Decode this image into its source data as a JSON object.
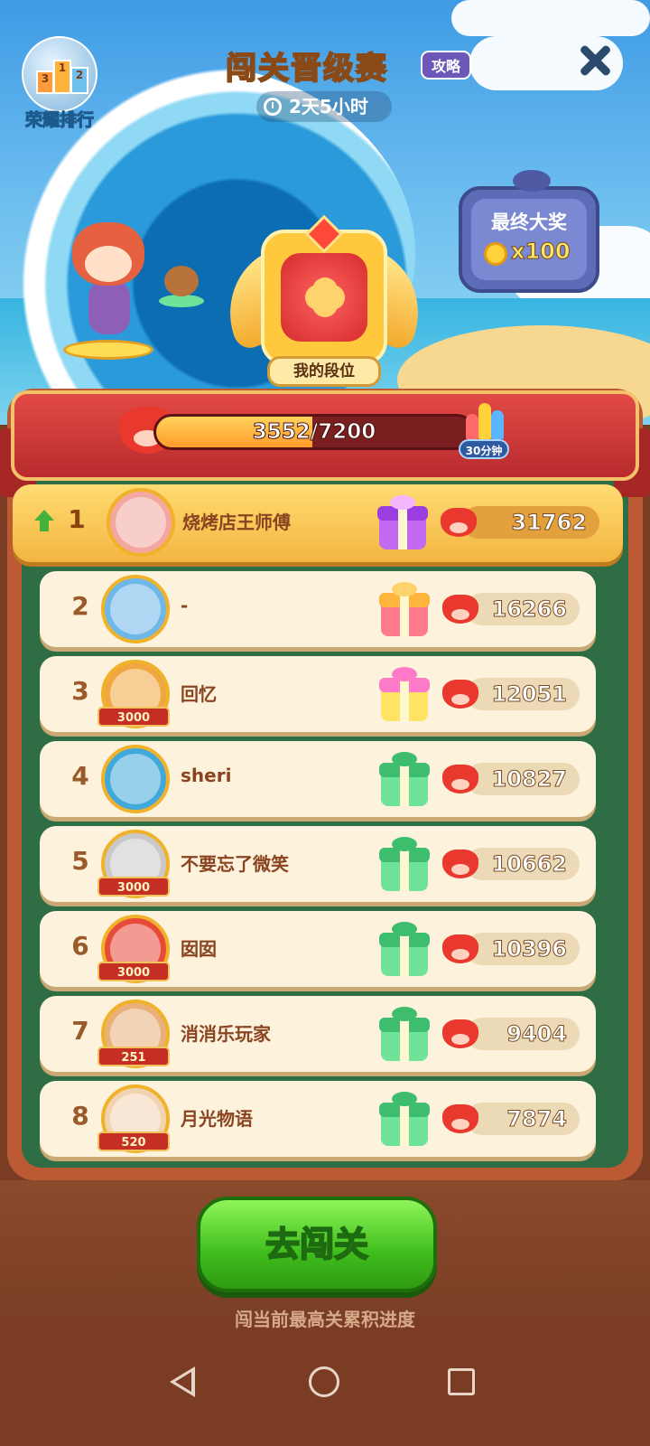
{
  "header": {
    "title": "闯关晋级赛",
    "guide_label": "攻略",
    "countdown": "2天5小时",
    "ranking_label": "荣耀排行",
    "podium": [
      "3",
      "1",
      "2"
    ]
  },
  "badge": {
    "label": "我的段位"
  },
  "grand_prize": {
    "title": "最终大奖",
    "amount": "x100"
  },
  "progress": {
    "current": 3552,
    "target": 7200,
    "text": "3552/7200",
    "fraction": 0.493,
    "reward_timer": "30分钟"
  },
  "leaderboard": [
    {
      "rank": "1",
      "name": "烧烤店王师傅",
      "score": "31762",
      "gift_color": "purple",
      "trend": "up"
    },
    {
      "rank": "2",
      "name": "-",
      "score": "16266",
      "gift_color": "pink-orange"
    },
    {
      "rank": "3",
      "name": "回忆",
      "score": "12051",
      "gift_color": "pink-yellow",
      "frame_tag": "3000"
    },
    {
      "rank": "4",
      "name": "sheri",
      "score": "10827",
      "gift_color": "green"
    },
    {
      "rank": "5",
      "name": "不要忘了微笑",
      "score": "10662",
      "gift_color": "green",
      "frame_tag": "3000"
    },
    {
      "rank": "6",
      "name": "囡囡",
      "score": "10396",
      "gift_color": "green",
      "frame_tag": "3000"
    },
    {
      "rank": "7",
      "name": "消消乐玩家",
      "score": "9404",
      "gift_color": "green",
      "frame_tag": "251"
    },
    {
      "rank": "8",
      "name": "月光物语",
      "score": "7874",
      "gift_color": "green",
      "frame_tag": "520"
    }
  ],
  "footer": {
    "play_button": "去闯关",
    "hint": "闯当前最高关累积进度"
  },
  "colors": {
    "accent_green": "#3fbd1c",
    "banner_red": "#d63a3c",
    "board_green": "#2f6e45"
  }
}
